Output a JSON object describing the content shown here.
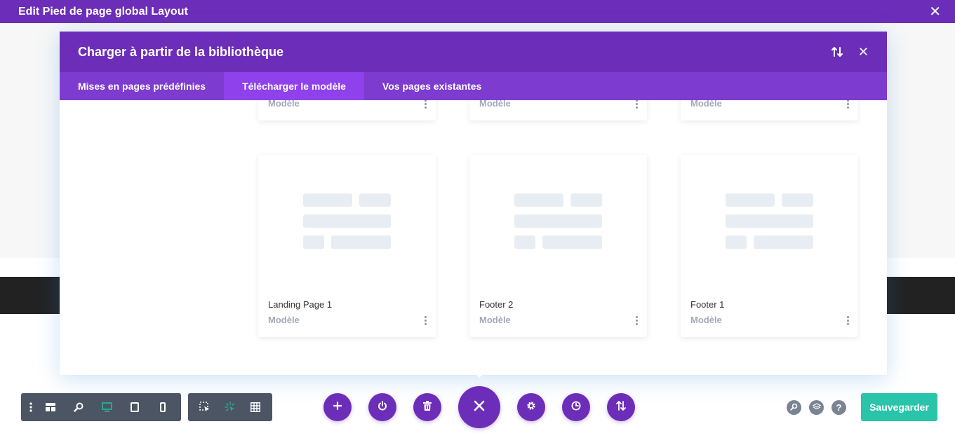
{
  "topbar": {
    "title": "Edit Pied de page global Layout",
    "close_symbol": "✕"
  },
  "modal": {
    "title": "Charger à partir de la bibliothèque",
    "close_symbol": "✕",
    "tabs": [
      {
        "label": "Mises en pages prédéfinies"
      },
      {
        "label": "Télécharger le modèle"
      },
      {
        "label": "Vos pages existantes"
      }
    ],
    "active_tab": "Télécharger le modèle",
    "top_row_cards": [
      {
        "type": "Modèle"
      },
      {
        "type": "Modèle"
      },
      {
        "type": "Modèle"
      }
    ],
    "cards": [
      {
        "name": "Landing Page 1",
        "type": "Modèle"
      },
      {
        "name": "Footer 2",
        "type": "Modèle"
      },
      {
        "name": "Footer 1",
        "type": "Modèle"
      }
    ]
  },
  "left_toolbar": {
    "items": [
      "menu-icon",
      "wireframe-icon",
      "zoom-icon",
      "desktop-icon",
      "tablet-icon",
      "phone-icon"
    ],
    "active_color": "#2ea58f"
  },
  "select_toolbar": {
    "items": [
      "click-mode-icon",
      "hover-mode-icon",
      "grid-icon"
    ]
  },
  "center_actions": [
    "add-icon",
    "power-icon",
    "trash-icon",
    "close-icon",
    "gear-icon",
    "history-icon",
    "sort-icon"
  ],
  "right_actions": {
    "help_symbol": "?",
    "save_label": "Sauvegarder"
  },
  "colors": {
    "primary": "#6c2eb9",
    "tabs": "#7d3bcf",
    "active_tab": "#8f42ec",
    "save": "#29c4a9",
    "toolbar": "#4b5563"
  }
}
